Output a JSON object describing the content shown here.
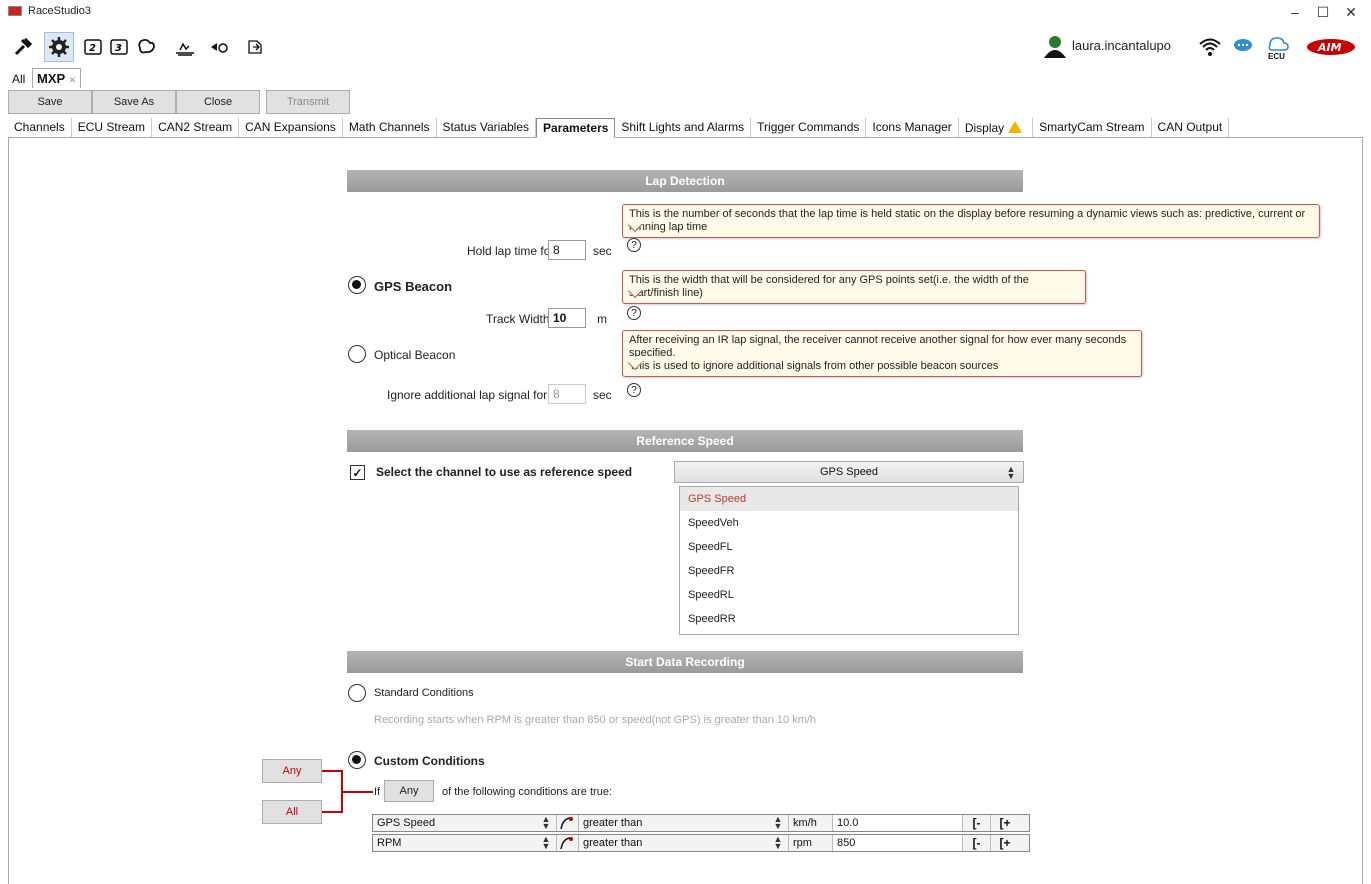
{
  "app": {
    "title": "RaceStudio3"
  },
  "window_controls": {
    "minimize": "–",
    "maximize": "☐",
    "close": "✕"
  },
  "toolbar": {
    "icons": [
      "tools-icon",
      "gear-icon",
      "device-1-icon",
      "device-3-icon",
      "track-icon",
      "wave-icon",
      "connect-icon",
      "export-icon"
    ]
  },
  "user": {
    "name": "laura.incantalupo",
    "ecu_label": "ECU"
  },
  "config_tabs": {
    "all": "All",
    "current": "MXP",
    "close": "✕"
  },
  "actions": {
    "save": "Save",
    "save_as": "Save As",
    "close": "Close",
    "transmit": "Transmit"
  },
  "tabs": [
    "Channels",
    "ECU Stream",
    "CAN2 Stream",
    "CAN Expansions",
    "Math Channels",
    "Status Variables",
    "Parameters",
    "Shift Lights and Alarms",
    "Trigger Commands",
    "Icons Manager",
    "Display",
    "SmartyCam Stream",
    "CAN Output"
  ],
  "lap_detection": {
    "header": "Lap Detection",
    "hold_label": "Hold lap time for",
    "hold_value": "8",
    "hold_unit": "sec",
    "hold_tip": "This is the number of seconds that the lap time is held static on the display before resuming a dynamic views such as: predictive, current or running lap time",
    "gps_beacon": "GPS Beacon",
    "track_width_label": "Track Width",
    "track_width_value": "10",
    "track_width_unit": "m",
    "track_width_tip": "This is the width that will be considered for any GPS points set(i.e. the width of the start/finish line)",
    "optical_beacon": "Optical Beacon",
    "ignore_label": "Ignore additional lap signal for",
    "ignore_value": "8",
    "ignore_unit": "sec",
    "ignore_tip_1": "After receiving an IR lap signal, the receiver cannot receive another signal for how ever many seconds specified.",
    "ignore_tip_2": "This is used to ignore additional signals from other possible beacon sources",
    "help": "?"
  },
  "reference_speed": {
    "header": "Reference Speed",
    "label": "Select the channel to use as reference speed",
    "checked": "✓",
    "selected": "GPS Speed",
    "options": [
      "GPS Speed",
      "SpeedVeh",
      "SpeedFL",
      "SpeedFR",
      "SpeedRL",
      "SpeedRR"
    ]
  },
  "start_recording": {
    "header": "Start Data Recording",
    "standard": "Standard Conditions",
    "standard_hint": "Recording starts when RPM is greater than 850 or speed(not GPS) is greater than 10 km/h",
    "custom": "Custom Conditions",
    "if": "If",
    "any_button": "Any",
    "suffix": "of the following conditions are true:",
    "callout_any": "Any",
    "callout_all": "All",
    "conditions": [
      {
        "channel": "GPS Speed",
        "op": "greater than",
        "unit": "km/h",
        "value": "10.0"
      },
      {
        "channel": "RPM",
        "op": "greater than",
        "unit": "rpm",
        "value": "850"
      }
    ]
  },
  "colors": {
    "accent_red": "#c00000",
    "header_gray": "#a6a6a6",
    "tooltip_bg": "#fffbe8",
    "warning": "#f0b400"
  }
}
